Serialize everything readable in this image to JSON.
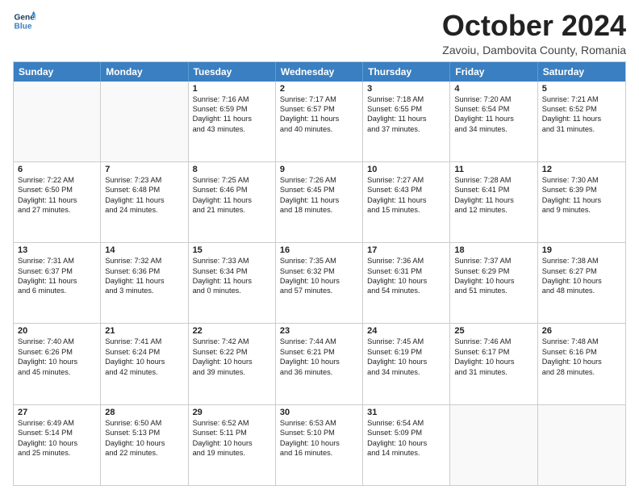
{
  "header": {
    "logo_line1": "General",
    "logo_line2": "Blue",
    "month": "October 2024",
    "location": "Zavoiu, Dambovita County, Romania"
  },
  "days": [
    "Sunday",
    "Monday",
    "Tuesday",
    "Wednesday",
    "Thursday",
    "Friday",
    "Saturday"
  ],
  "weeks": [
    [
      {
        "day": "",
        "lines": [],
        "empty": true
      },
      {
        "day": "",
        "lines": [],
        "empty": true
      },
      {
        "day": "1",
        "lines": [
          "Sunrise: 7:16 AM",
          "Sunset: 6:59 PM",
          "Daylight: 11 hours",
          "and 43 minutes."
        ]
      },
      {
        "day": "2",
        "lines": [
          "Sunrise: 7:17 AM",
          "Sunset: 6:57 PM",
          "Daylight: 11 hours",
          "and 40 minutes."
        ]
      },
      {
        "day": "3",
        "lines": [
          "Sunrise: 7:18 AM",
          "Sunset: 6:55 PM",
          "Daylight: 11 hours",
          "and 37 minutes."
        ]
      },
      {
        "day": "4",
        "lines": [
          "Sunrise: 7:20 AM",
          "Sunset: 6:54 PM",
          "Daylight: 11 hours",
          "and 34 minutes."
        ]
      },
      {
        "day": "5",
        "lines": [
          "Sunrise: 7:21 AM",
          "Sunset: 6:52 PM",
          "Daylight: 11 hours",
          "and 31 minutes."
        ]
      }
    ],
    [
      {
        "day": "6",
        "lines": [
          "Sunrise: 7:22 AM",
          "Sunset: 6:50 PM",
          "Daylight: 11 hours",
          "and 27 minutes."
        ]
      },
      {
        "day": "7",
        "lines": [
          "Sunrise: 7:23 AM",
          "Sunset: 6:48 PM",
          "Daylight: 11 hours",
          "and 24 minutes."
        ]
      },
      {
        "day": "8",
        "lines": [
          "Sunrise: 7:25 AM",
          "Sunset: 6:46 PM",
          "Daylight: 11 hours",
          "and 21 minutes."
        ]
      },
      {
        "day": "9",
        "lines": [
          "Sunrise: 7:26 AM",
          "Sunset: 6:45 PM",
          "Daylight: 11 hours",
          "and 18 minutes."
        ]
      },
      {
        "day": "10",
        "lines": [
          "Sunrise: 7:27 AM",
          "Sunset: 6:43 PM",
          "Daylight: 11 hours",
          "and 15 minutes."
        ]
      },
      {
        "day": "11",
        "lines": [
          "Sunrise: 7:28 AM",
          "Sunset: 6:41 PM",
          "Daylight: 11 hours",
          "and 12 minutes."
        ]
      },
      {
        "day": "12",
        "lines": [
          "Sunrise: 7:30 AM",
          "Sunset: 6:39 PM",
          "Daylight: 11 hours",
          "and 9 minutes."
        ]
      }
    ],
    [
      {
        "day": "13",
        "lines": [
          "Sunrise: 7:31 AM",
          "Sunset: 6:37 PM",
          "Daylight: 11 hours",
          "and 6 minutes."
        ]
      },
      {
        "day": "14",
        "lines": [
          "Sunrise: 7:32 AM",
          "Sunset: 6:36 PM",
          "Daylight: 11 hours",
          "and 3 minutes."
        ]
      },
      {
        "day": "15",
        "lines": [
          "Sunrise: 7:33 AM",
          "Sunset: 6:34 PM",
          "Daylight: 11 hours",
          "and 0 minutes."
        ]
      },
      {
        "day": "16",
        "lines": [
          "Sunrise: 7:35 AM",
          "Sunset: 6:32 PM",
          "Daylight: 10 hours",
          "and 57 minutes."
        ]
      },
      {
        "day": "17",
        "lines": [
          "Sunrise: 7:36 AM",
          "Sunset: 6:31 PM",
          "Daylight: 10 hours",
          "and 54 minutes."
        ]
      },
      {
        "day": "18",
        "lines": [
          "Sunrise: 7:37 AM",
          "Sunset: 6:29 PM",
          "Daylight: 10 hours",
          "and 51 minutes."
        ]
      },
      {
        "day": "19",
        "lines": [
          "Sunrise: 7:38 AM",
          "Sunset: 6:27 PM",
          "Daylight: 10 hours",
          "and 48 minutes."
        ]
      }
    ],
    [
      {
        "day": "20",
        "lines": [
          "Sunrise: 7:40 AM",
          "Sunset: 6:26 PM",
          "Daylight: 10 hours",
          "and 45 minutes."
        ]
      },
      {
        "day": "21",
        "lines": [
          "Sunrise: 7:41 AM",
          "Sunset: 6:24 PM",
          "Daylight: 10 hours",
          "and 42 minutes."
        ]
      },
      {
        "day": "22",
        "lines": [
          "Sunrise: 7:42 AM",
          "Sunset: 6:22 PM",
          "Daylight: 10 hours",
          "and 39 minutes."
        ]
      },
      {
        "day": "23",
        "lines": [
          "Sunrise: 7:44 AM",
          "Sunset: 6:21 PM",
          "Daylight: 10 hours",
          "and 36 minutes."
        ]
      },
      {
        "day": "24",
        "lines": [
          "Sunrise: 7:45 AM",
          "Sunset: 6:19 PM",
          "Daylight: 10 hours",
          "and 34 minutes."
        ]
      },
      {
        "day": "25",
        "lines": [
          "Sunrise: 7:46 AM",
          "Sunset: 6:17 PM",
          "Daylight: 10 hours",
          "and 31 minutes."
        ]
      },
      {
        "day": "26",
        "lines": [
          "Sunrise: 7:48 AM",
          "Sunset: 6:16 PM",
          "Daylight: 10 hours",
          "and 28 minutes."
        ]
      }
    ],
    [
      {
        "day": "27",
        "lines": [
          "Sunrise: 6:49 AM",
          "Sunset: 5:14 PM",
          "Daylight: 10 hours",
          "and 25 minutes."
        ]
      },
      {
        "day": "28",
        "lines": [
          "Sunrise: 6:50 AM",
          "Sunset: 5:13 PM",
          "Daylight: 10 hours",
          "and 22 minutes."
        ]
      },
      {
        "day": "29",
        "lines": [
          "Sunrise: 6:52 AM",
          "Sunset: 5:11 PM",
          "Daylight: 10 hours",
          "and 19 minutes."
        ]
      },
      {
        "day": "30",
        "lines": [
          "Sunrise: 6:53 AM",
          "Sunset: 5:10 PM",
          "Daylight: 10 hours",
          "and 16 minutes."
        ]
      },
      {
        "day": "31",
        "lines": [
          "Sunrise: 6:54 AM",
          "Sunset: 5:09 PM",
          "Daylight: 10 hours",
          "and 14 minutes."
        ]
      },
      {
        "day": "",
        "lines": [],
        "empty": true
      },
      {
        "day": "",
        "lines": [],
        "empty": true
      }
    ]
  ]
}
